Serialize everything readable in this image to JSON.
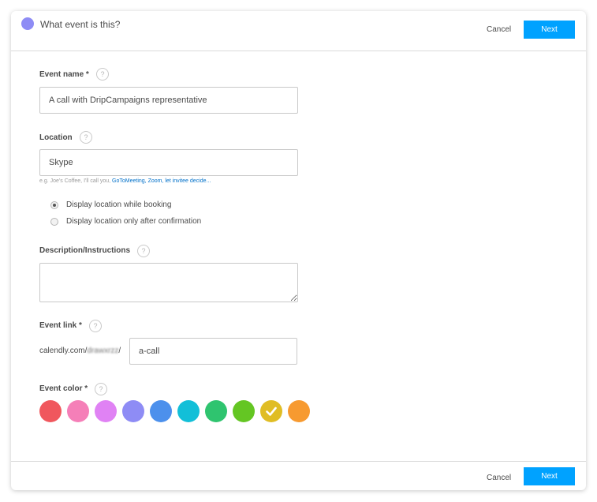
{
  "header": {
    "title": "What event is this?",
    "dot_color": "#8e8cf5",
    "cancel_label": "Cancel",
    "next_label": "Next"
  },
  "footer": {
    "cancel_label": "Cancel",
    "next_label": "Next"
  },
  "accent_color": "#00a2ff",
  "form": {
    "event_name": {
      "label": "Event name *",
      "value": "A call with DripCampaigns representative"
    },
    "location": {
      "label": "Location",
      "value": "Skype",
      "hint_prefix": "e.g. Joe's Coffee, I'll call you, ",
      "hint_link": "GoToMeeting, Zoom, let invitee decide...",
      "options": [
        {
          "label": "Display location while booking",
          "checked": true
        },
        {
          "label": "Display location only after confirmation",
          "checked": false
        }
      ]
    },
    "description": {
      "label": "Description/Instructions",
      "value": ""
    },
    "event_link": {
      "label": "Event link *",
      "prefix": "calendly.com/",
      "blurred_slug": "drawxrzz",
      "suffix": "/",
      "value": "a-call"
    },
    "event_color": {
      "label": "Event color *",
      "selected_index": 8,
      "colors": [
        "#f0575d",
        "#f57fb8",
        "#e082f4",
        "#8e8cf5",
        "#4c90ec",
        "#12bfd8",
        "#2fc46f",
        "#64c623",
        "#e0bd24",
        "#f79a30"
      ]
    }
  },
  "help_glyph": "?"
}
